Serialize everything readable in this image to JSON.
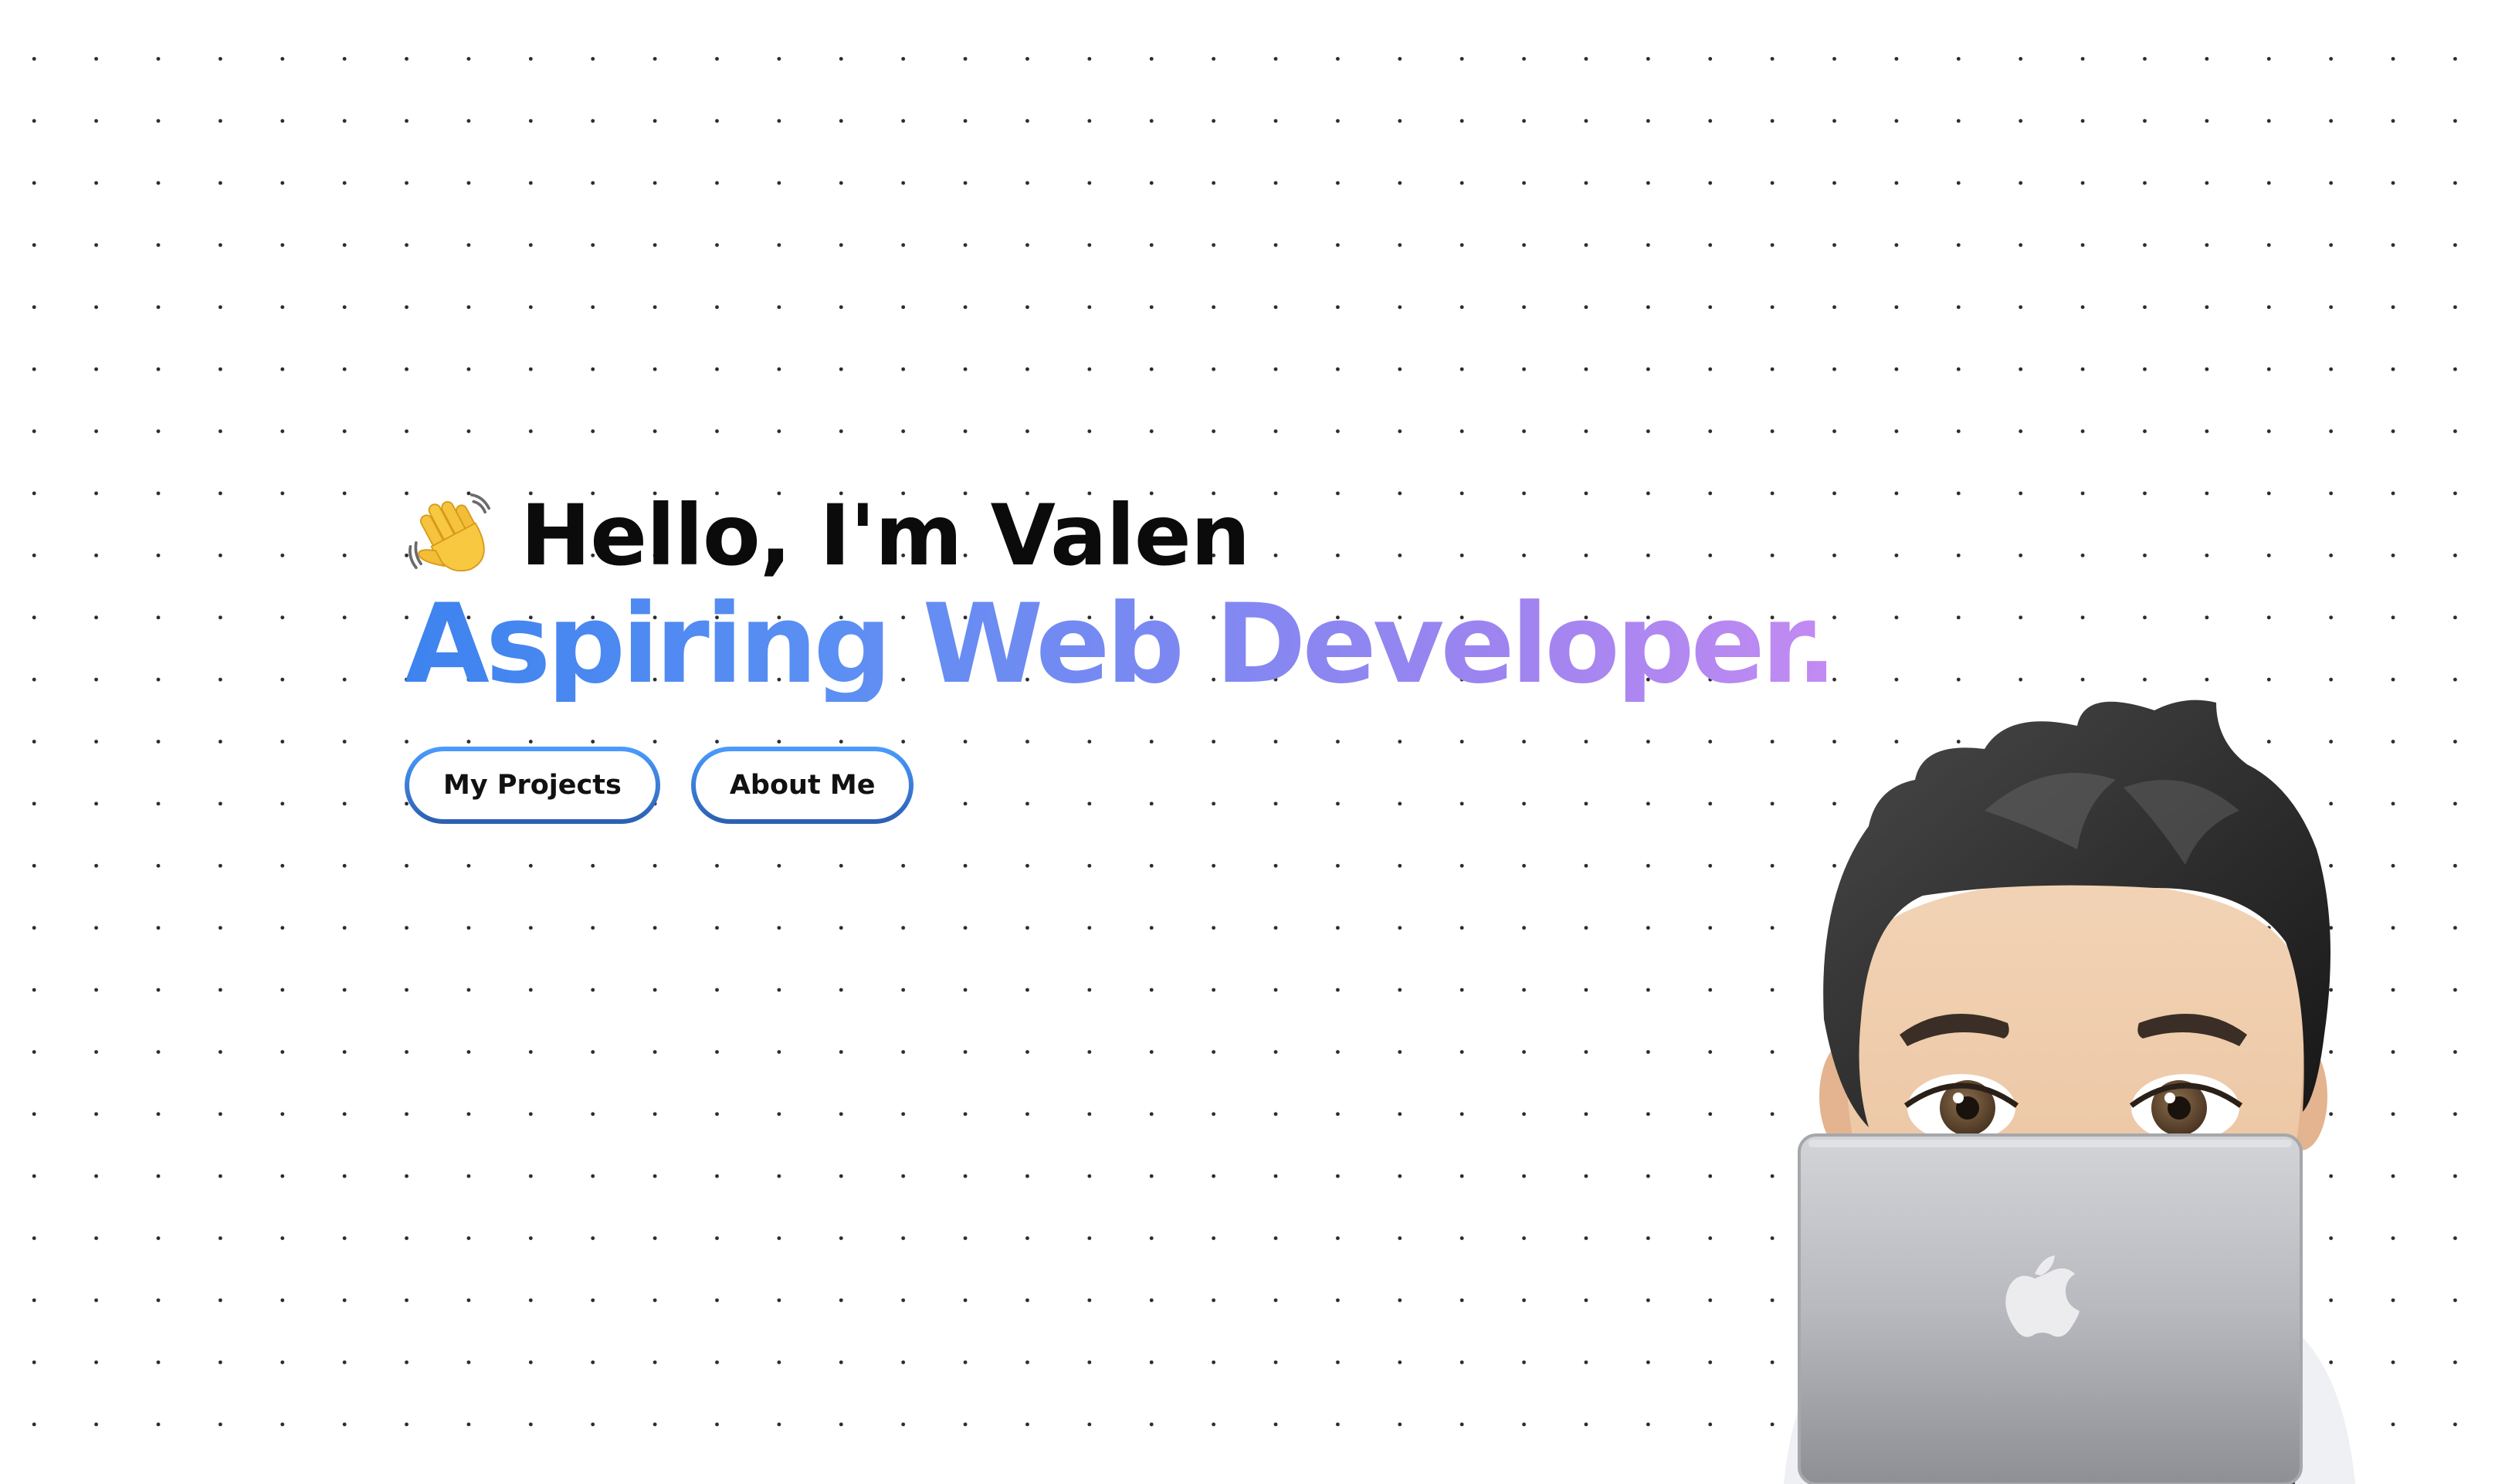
{
  "hero": {
    "greeting": "Hello, I'm Valen",
    "greeting_icon": "waving-hand-icon",
    "headline": "Aspiring Web Developer.",
    "headline_gradient": [
      "#3d83ef",
      "#c38bf2"
    ],
    "buttons": [
      {
        "label": "My Projects"
      },
      {
        "label": "About Me"
      }
    ],
    "button_border_colors": [
      "#4a9cff",
      "#2b5fb1"
    ]
  },
  "illustration": {
    "icon": "memoji-developer-with-laptop-icon",
    "laptop_logo": "apple-logo-icon"
  }
}
